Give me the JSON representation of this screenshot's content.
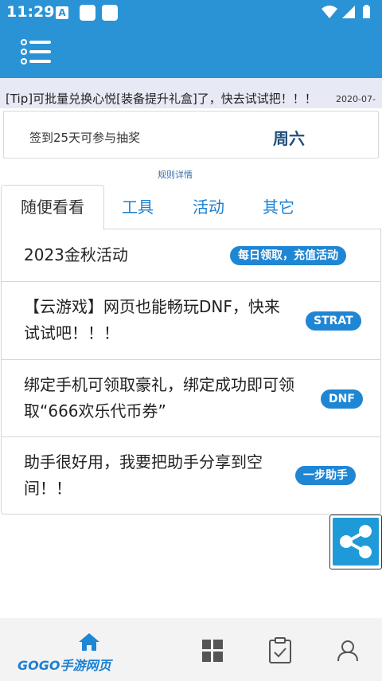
{
  "status_bar": {
    "time": "11:29",
    "a_icon": "A"
  },
  "notice": {
    "text": "[Tip]可批量兑换心悦[装备提升礼盒]了，快去试试把！！！",
    "date": "2020-07-"
  },
  "signin": {
    "text": "签到25天可参与抽奖",
    "day": "周六",
    "rules_link": "规则详情"
  },
  "tabs": [
    {
      "label": "随便看看",
      "active": true
    },
    {
      "label": "工具",
      "active": false
    },
    {
      "label": "活动",
      "active": false
    },
    {
      "label": "其它",
      "active": false
    }
  ],
  "items": [
    {
      "title_line1": "2023金秋活动",
      "title_line2": "",
      "badge": "每日领取，充值活动"
    },
    {
      "title_line1": "【云游戏】网页也能畅玩DNF，快来",
      "title_line2": "试试吧！！！",
      "badge": "STRAT"
    },
    {
      "title_line1": "绑定手机可领取豪礼，绑定成功即可领",
      "title_line2": "取“666欢乐代币券”",
      "badge": "DNF"
    },
    {
      "title_line1": "助手很好用，我要把助手分享到空",
      "title_line2": "间！！",
      "badge": "一步助手"
    }
  ],
  "watermark": "GOGO手游网页",
  "colors": {
    "primary": "#2a93d5",
    "badge": "#1f86d4",
    "tab": "#1a7fd0"
  },
  "icons": [
    "menu-icon",
    "share-icon",
    "home-icon",
    "grid-icon",
    "clipboard-check-icon",
    "person-icon"
  ]
}
